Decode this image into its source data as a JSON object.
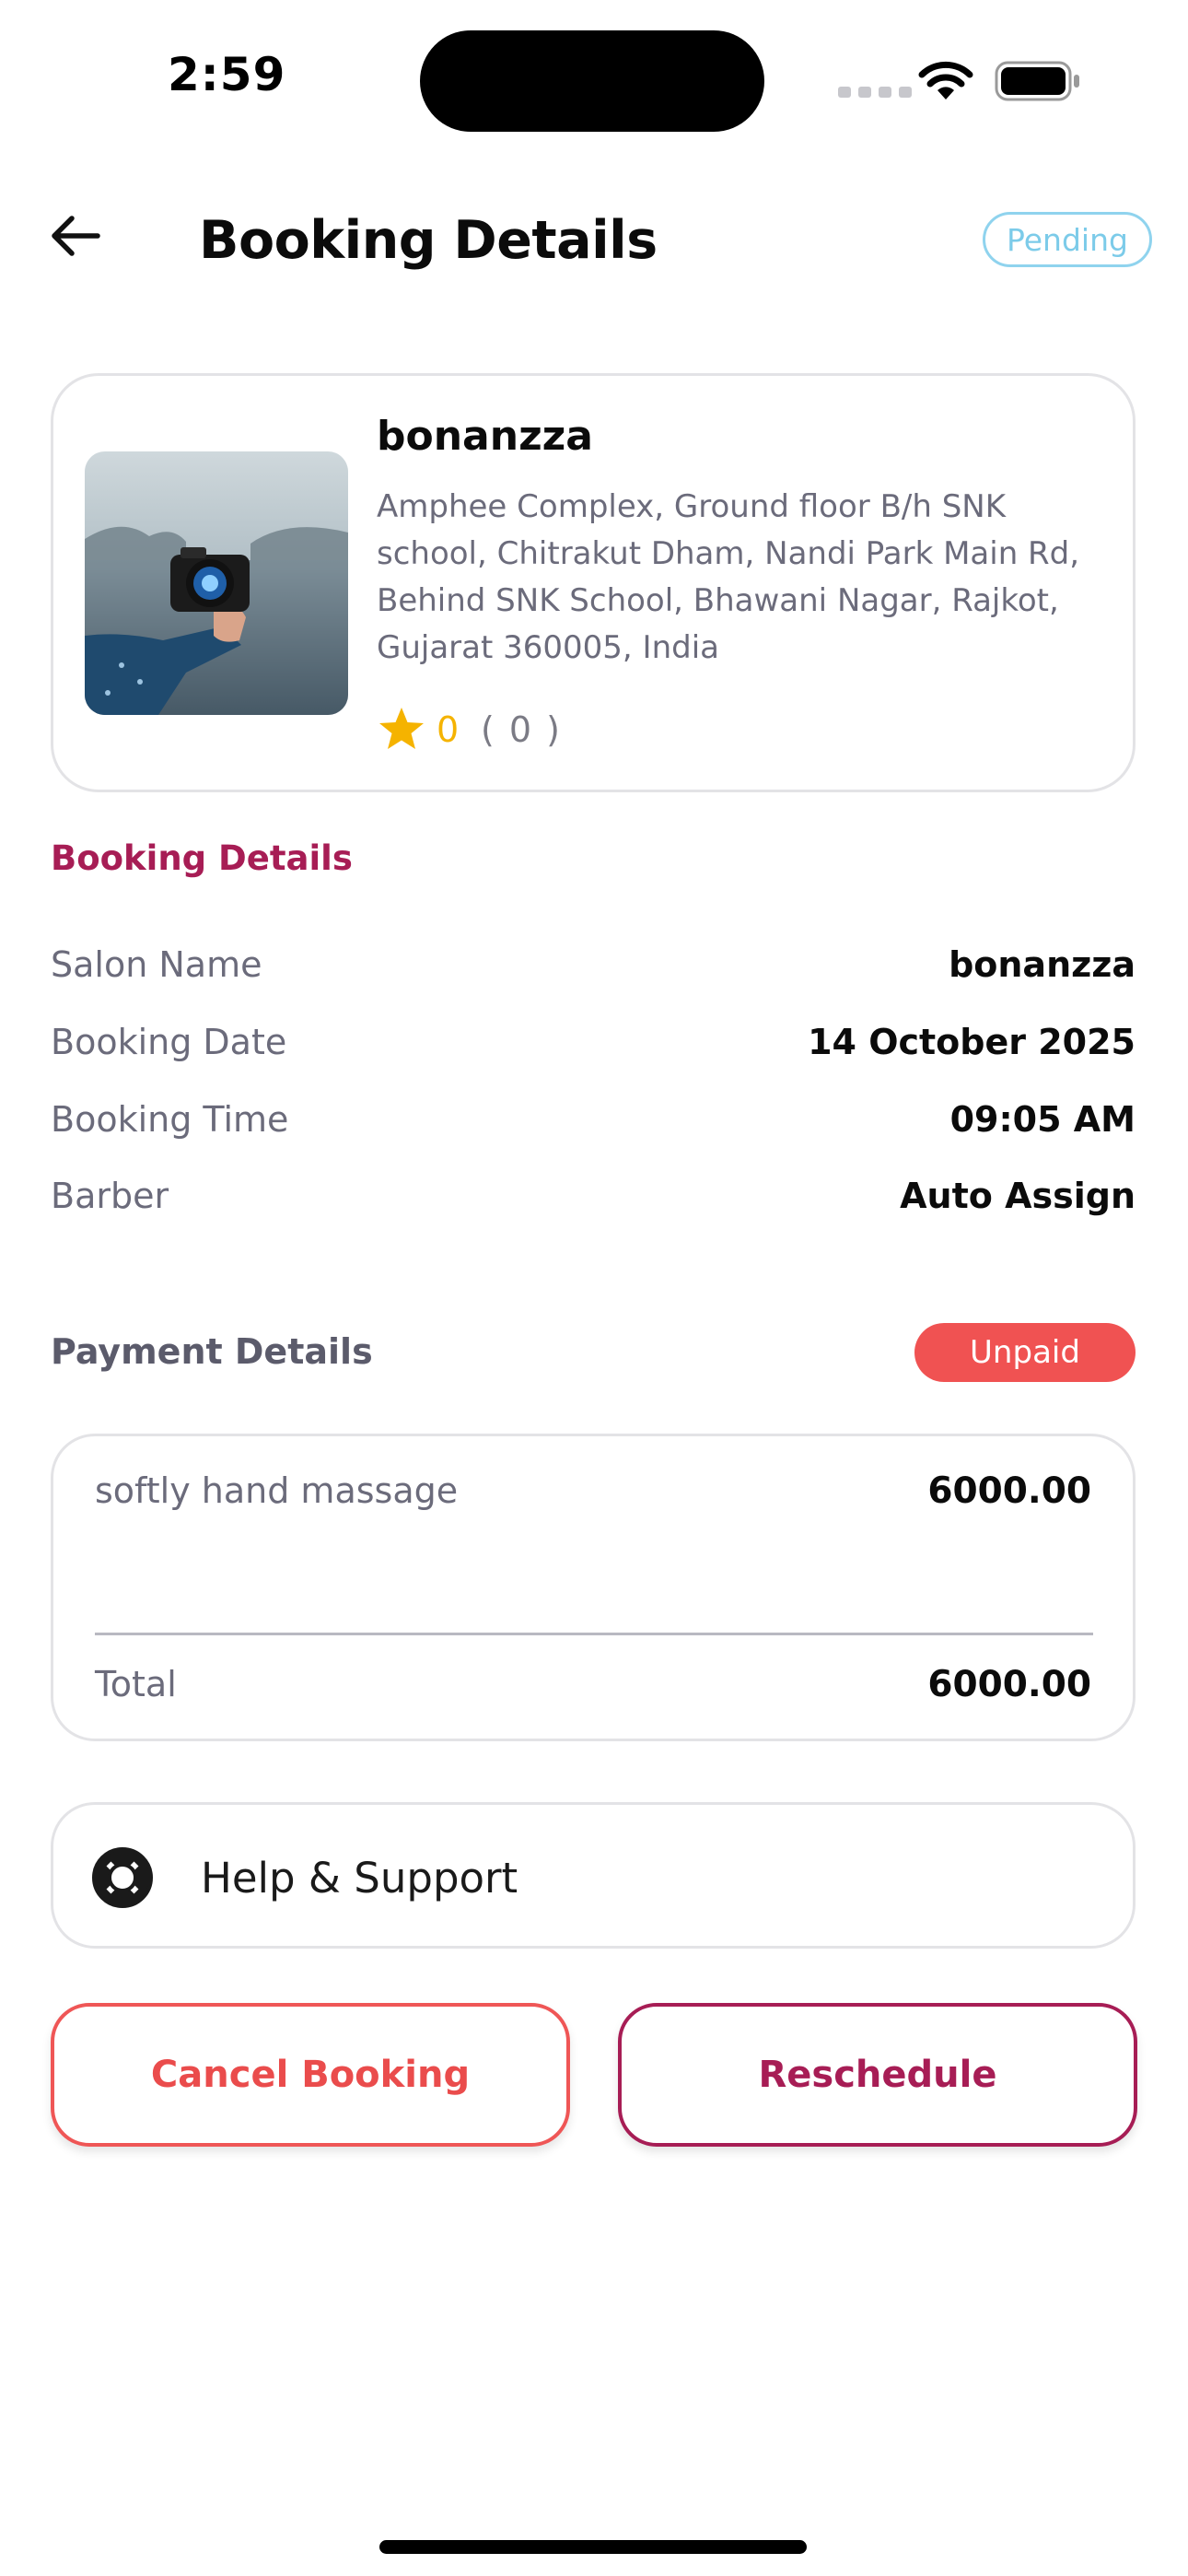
{
  "status_bar": {
    "time": "2:59"
  },
  "header": {
    "title": "Booking Details",
    "status": "Pending"
  },
  "salon": {
    "name": "bonanzza",
    "address": "Amphee Complex, Ground floor B/h SNK school, Chitrakut Dham, Nandi Park Main Rd, Behind SNK School, Bhawani Nagar, Rajkot, Gujarat 360005, India",
    "rating": "0",
    "review_count": "( 0 )"
  },
  "booking_details": {
    "heading": "Booking Details",
    "rows": [
      {
        "label": "Salon Name",
        "value": "bonanzza"
      },
      {
        "label": "Booking Date",
        "value": "14 October 2025"
      },
      {
        "label": "Booking Time",
        "value": "09:05 AM"
      },
      {
        "label": "Barber",
        "value": "Auto Assign"
      }
    ]
  },
  "payment": {
    "heading": "Payment Details",
    "status": "Unpaid",
    "items": [
      {
        "name": "softly hand massage",
        "price": "6000.00"
      }
    ],
    "total_label": "Total",
    "total_value": "6000.00"
  },
  "support": {
    "label": "Help & Support"
  },
  "actions": {
    "cancel_label": "Cancel Booking",
    "reschedule_label": "Reschedule"
  },
  "colors": {
    "accent": "#a71d55",
    "danger": "#f05252",
    "pending": "#8fd3ee",
    "star": "#f5b300"
  },
  "icons": {
    "back": "arrow-left-icon",
    "rating": "star-icon",
    "support": "lifebuoy-icon",
    "wifi": "wifi-icon",
    "battery": "battery-icon"
  }
}
